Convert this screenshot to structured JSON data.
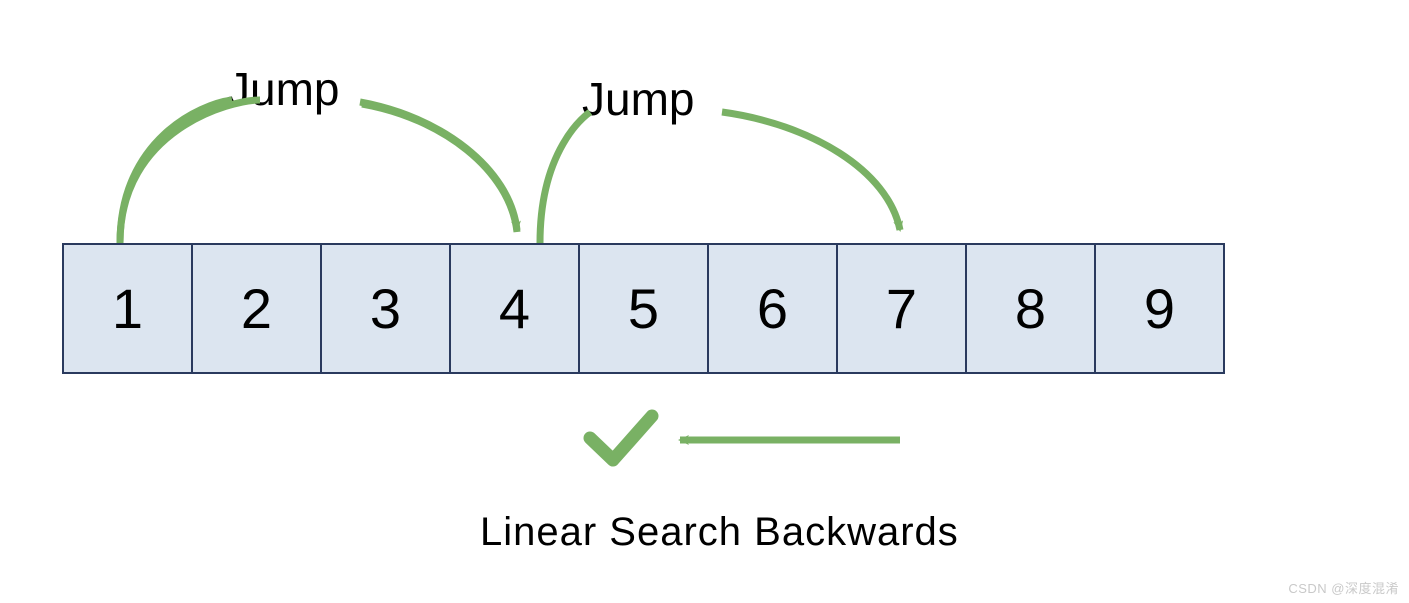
{
  "array": {
    "cells": [
      "1",
      "2",
      "3",
      "4",
      "5",
      "6",
      "7",
      "8",
      "9"
    ]
  },
  "labels": {
    "jump1": "Jump",
    "jump2": "Jump",
    "linear_search": "Linear Search Backwards"
  },
  "watermark": "CSDN @深度混淆",
  "colors": {
    "arrow": "#79b164",
    "check": "#79b164",
    "cell_fill": "#dce5f0",
    "cell_border": "#2a3a5e"
  },
  "diagram": {
    "type": "jump-search",
    "jumps": [
      {
        "from_index": 0,
        "to_index": 3,
        "label": "Jump"
      },
      {
        "from_index": 3,
        "to_index": 6,
        "label": "Jump"
      }
    ],
    "linear_search": {
      "direction": "backwards",
      "from_index": 6,
      "found_index": 4
    }
  }
}
